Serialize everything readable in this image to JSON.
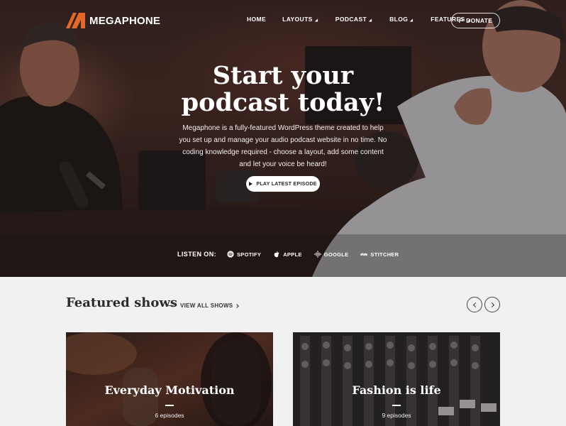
{
  "brand": {
    "name": "MEGAPHONE",
    "accent": "#e2692a"
  },
  "nav": {
    "items": [
      {
        "label": "HOME",
        "dropdown": false
      },
      {
        "label": "LAYOUTS",
        "dropdown": true
      },
      {
        "label": "PODCAST",
        "dropdown": true
      },
      {
        "label": "BLOG",
        "dropdown": true
      },
      {
        "label": "FEATURES",
        "dropdown": true
      }
    ],
    "donate_label": "DONATE",
    "donate_icon": "paypal-icon"
  },
  "hero": {
    "title_line1": "Start your",
    "title_line2": "podcast today!",
    "description": "Megaphone is a fully-featured WordPress theme created to help you set up and manage your audio podcast website in no time. No coding knowledge required - choose a layout, add some content and let your voice be heard!",
    "play_button": "PLAY LATEST EPISODE"
  },
  "listen": {
    "label": "LISTEN ON:",
    "platforms": [
      {
        "name": "SPOTIFY",
        "icon": "spotify-icon"
      },
      {
        "name": "APPLE",
        "icon": "apple-icon"
      },
      {
        "name": "GOOGLE",
        "icon": "google-podcasts-icon"
      },
      {
        "name": "STITCHER",
        "icon": "stitcher-icon"
      }
    ]
  },
  "featured": {
    "title": "Featured shows",
    "view_all": "VIEW ALL SHOWS",
    "shows": [
      {
        "title": "Everyday Motivation",
        "count": "6 episodes"
      },
      {
        "title": "Fashion is life",
        "count": "9 episodes"
      }
    ]
  }
}
